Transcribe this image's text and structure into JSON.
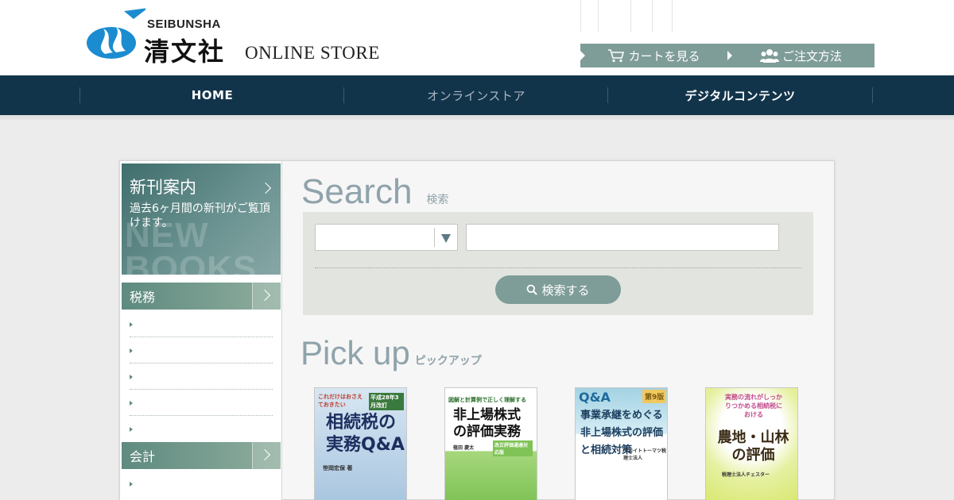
{
  "header": {
    "brand_en": "SEIBUNSHA",
    "brand_jp": "清文社",
    "brand_store": "ONLINE STORE",
    "top_links": [
      {
        "label": "カートを見る",
        "icon": "cart-icon"
      },
      {
        "label": "ご注文方法",
        "icon": "users-icon"
      }
    ]
  },
  "nav": {
    "items": [
      {
        "label": "HOME"
      },
      {
        "label": "オンラインストア"
      },
      {
        "label": "デジタルコンテンツ"
      }
    ]
  },
  "sidebar": {
    "new_books": {
      "title": "新刊案内",
      "description": "過去6ヶ月間の新刊がご覧頂けます。",
      "watermark": "NEW BOOKS"
    },
    "categories": [
      {
        "label": "税務",
        "item_count": 5
      },
      {
        "label": "会計",
        "item_count": 1
      }
    ]
  },
  "search": {
    "title": "Search",
    "subtitle": "検索",
    "select_value": "",
    "input_value": "",
    "button_label": "検索する"
  },
  "pickup": {
    "title": "Pick up",
    "subtitle": "ピックアップ",
    "books": [
      {
        "cover_text": "相続税の実務Q&A",
        "badge": "平成28年3月改訂",
        "tagline": "これだけはおさえておきたい",
        "author": "笹岡宏保 著"
      },
      {
        "cover_text": "非上場株式の評価実務",
        "badge": "改正評価通達対応版",
        "tagline": "図解と計算例で正しく理解する",
        "author": "植田 慶太"
      },
      {
        "cover_text": "事業承継をめぐる非上場株式の評価と相続対策",
        "badge": "第9版",
        "tagline": "Q&A",
        "author": "デロイトトーマツ税理士法人"
      },
      {
        "cover_text": "農地・山林の評価",
        "badge": "",
        "tagline": "実務の流れがしっかりつかめる相続税における",
        "author": "税理士法人チェスター"
      }
    ]
  },
  "colors": {
    "nav_bg": "#12344b",
    "accent": "#7e9c98",
    "heading": "#8fa3ab",
    "category": "#5e8a7f"
  }
}
